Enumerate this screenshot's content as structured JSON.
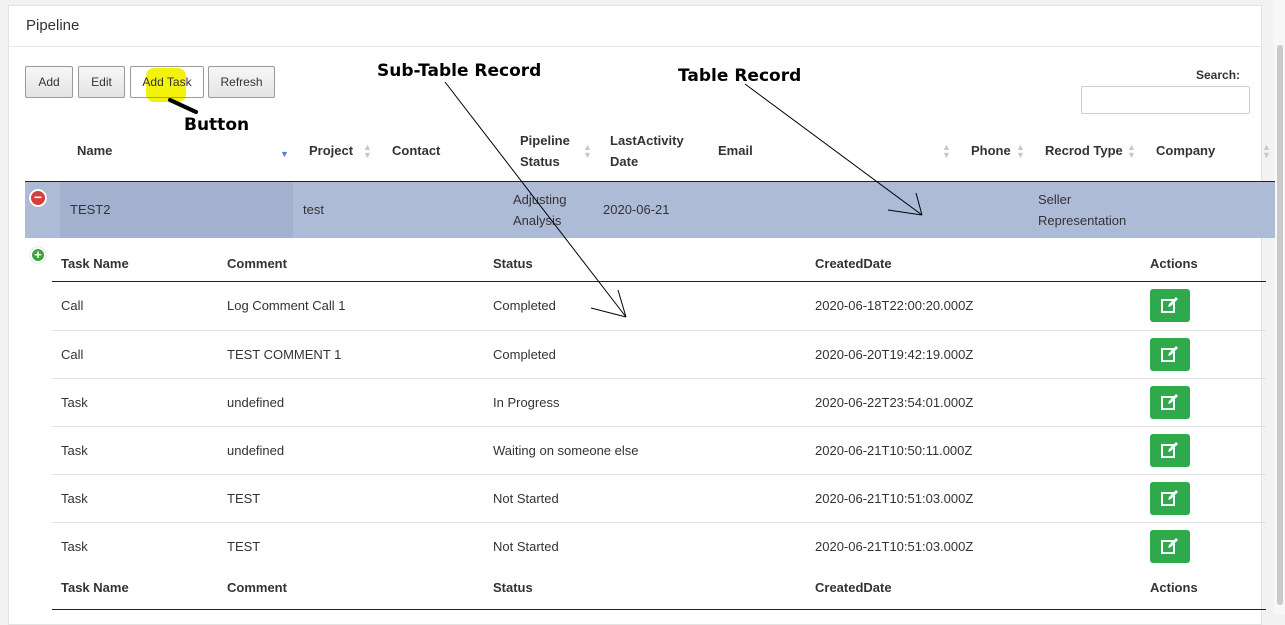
{
  "panel": {
    "title": "Pipeline"
  },
  "toolbar": {
    "add_label": "Add",
    "edit_label": "Edit",
    "add_task_label": "Add Task",
    "refresh_label": "Refresh"
  },
  "search": {
    "label": "Search:",
    "value": ""
  },
  "table": {
    "columns": [
      "Name",
      "Project",
      "Contact",
      "Pipeline Status",
      "LastActivity Date",
      "Email",
      "Phone",
      "Recrod Type",
      "Company"
    ],
    "row": {
      "name": "TEST2",
      "project": "test",
      "contact": "",
      "pipeline_status": "Adjusting Analysis",
      "last_activity_date": "2020-06-21",
      "email": "",
      "phone": "",
      "record_type": "Seller Representation",
      "company": ""
    }
  },
  "subtable": {
    "columns": [
      "Task Name",
      "Comment",
      "Status",
      "CreatedDate",
      "Actions"
    ],
    "rows": [
      {
        "task_name": "Call",
        "comment": "Log Comment Call 1",
        "status": "Completed",
        "created": "2020-06-18T22:00:20.000Z"
      },
      {
        "task_name": "Call",
        "comment": "TEST COMMENT 1",
        "status": "Completed",
        "created": "2020-06-20T19:42:19.000Z"
      },
      {
        "task_name": "Task",
        "comment": "undefined",
        "status": "In Progress",
        "created": "2020-06-22T23:54:01.000Z"
      },
      {
        "task_name": "Task",
        "comment": "undefined",
        "status": "Waiting on someone else",
        "created": "2020-06-21T10:50:11.000Z"
      },
      {
        "task_name": "Task",
        "comment": "TEST",
        "status": "Not Started",
        "created": "2020-06-21T10:51:03.000Z"
      },
      {
        "task_name": "Task",
        "comment": "TEST",
        "status": "Not Started",
        "created": "2020-06-21T10:51:03.000Z"
      }
    ]
  },
  "annotations": {
    "button": "Button",
    "sub_table_record": "Sub-Table Record",
    "table_record": "Table Record"
  },
  "icons": {
    "collapse": "minus-circle-icon",
    "expand": "plus-circle-icon",
    "edit": "edit-icon",
    "sort": "sort-icon"
  },
  "colors": {
    "selected_row": "#aebbd7",
    "edit_button": "#2eaa4d",
    "collapse_icon": "#d43f3a",
    "expand_icon": "#3aa63a",
    "highlight": "#f2f20a"
  }
}
